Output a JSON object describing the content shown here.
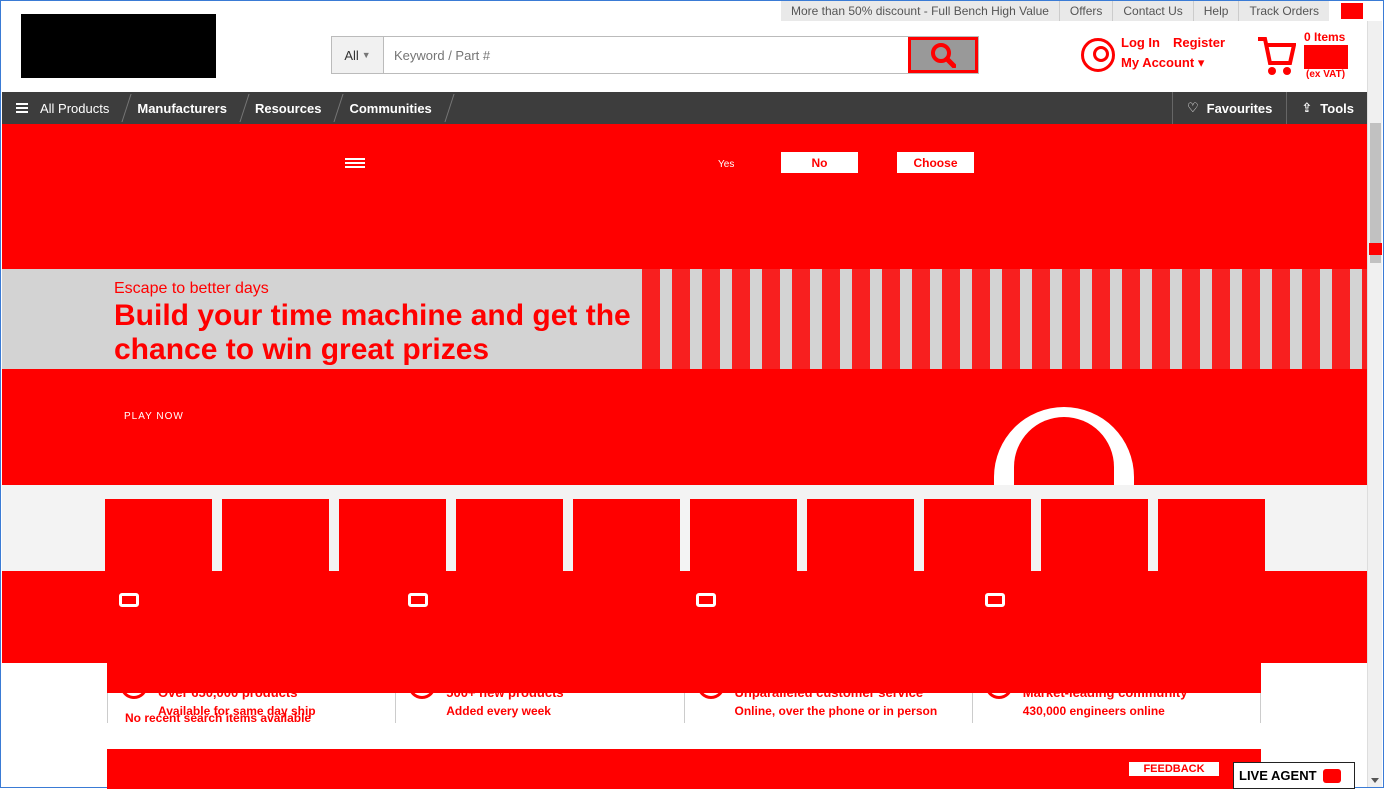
{
  "util_bar": {
    "promo": "More than 50% discount - Full Bench High Value",
    "offers": "Offers",
    "contact": "Contact Us",
    "help": "Help",
    "track": "Track Orders"
  },
  "search": {
    "category": "All",
    "placeholder": "Keyword / Part #"
  },
  "account": {
    "login": "Log In",
    "register": "Register",
    "my_account": "My Account"
  },
  "cart": {
    "items": "0 Items",
    "vat": "(ex VAT)"
  },
  "nav": {
    "all_products": "All Products",
    "manufacturers": "Manufacturers",
    "resources": "Resources",
    "communities": "Communities",
    "favourites": "Favourites",
    "tools": "Tools"
  },
  "hero": {
    "yes": "Yes",
    "no": "No",
    "choose": "Choose",
    "kicker": "Escape to better days",
    "title": "Build your time machine and get the chance to win great prizes",
    "play": "PLAY NOW"
  },
  "props_top": [
    {
      "title": "Over 650,000 products"
    },
    {
      "title": "500+ new products"
    },
    {
      "title": "Unparalleled customer service"
    },
    {
      "title": "Market-leading community"
    }
  ],
  "props": [
    {
      "title": "Over 650,000 products",
      "sub": "Available for same day ship"
    },
    {
      "title": "500+ new products",
      "sub": "Added every week"
    },
    {
      "title": "Unparalleled customer service",
      "sub": "Online, over the phone or in person"
    },
    {
      "title": "Market-leading community",
      "sub": "430,000 engineers online"
    }
  ],
  "recent": "No recent search items available",
  "footer": {
    "feedback": "FEEDBACK",
    "live_agent": "LIVE AGENT"
  },
  "colors": {
    "accent": "#ff0000",
    "nav_bg": "#3d3d3d",
    "band_gray": "#d3d3d3"
  }
}
